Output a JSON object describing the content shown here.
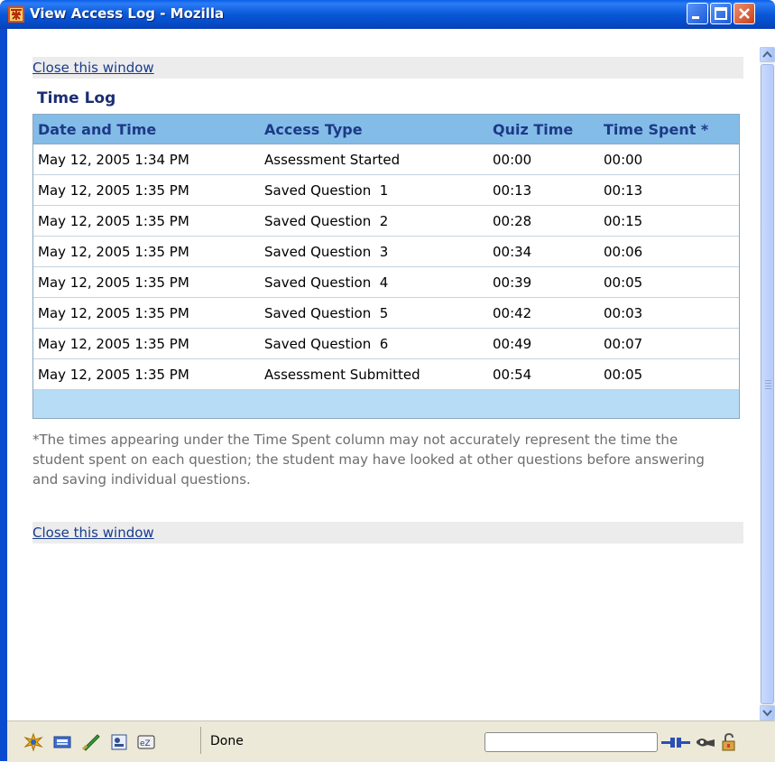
{
  "window": {
    "title": "View Access Log - Mozilla",
    "controls": [
      "minimize-icon",
      "maximize-icon",
      "close-icon"
    ]
  },
  "links": {
    "close_top": "Close this window",
    "close_bottom": "Close this window"
  },
  "time_log": {
    "title": "Time Log",
    "columns": [
      "Date and Time",
      "Access Type",
      "Quiz Time",
      "Time Spent *"
    ],
    "rows": [
      [
        "May 12, 2005 1:34 PM",
        "Assessment Started",
        "00:00",
        "00:00"
      ],
      [
        "May 12, 2005 1:35 PM",
        "Saved Question  1",
        "00:13",
        "00:13"
      ],
      [
        "May 12, 2005 1:35 PM",
        "Saved Question  2",
        "00:28",
        "00:15"
      ],
      [
        "May 12, 2005 1:35 PM",
        "Saved Question  3",
        "00:34",
        "00:06"
      ],
      [
        "May 12, 2005 1:35 PM",
        "Saved Question  4",
        "00:39",
        "00:05"
      ],
      [
        "May 12, 2005 1:35 PM",
        "Saved Question  5",
        "00:42",
        "00:03"
      ],
      [
        "May 12, 2005 1:35 PM",
        "Saved Question  6",
        "00:49",
        "00:07"
      ],
      [
        "May 12, 2005 1:35 PM",
        "Assessment Submitted",
        "00:54",
        "00:05"
      ]
    ],
    "footnote": "*The times appearing under the Time Spent column may not accurately represent the time the student spent on each question; the student may have looked at other questions before answering and saving individual questions."
  },
  "status_bar": {
    "text": "Done",
    "icons": [
      "navigator-icon",
      "mail-icon",
      "composer-icon",
      "address-book-icon",
      "irc-chat-icon"
    ],
    "right_icons": [
      "online-plug-icon",
      "security-icon",
      "lock-icon"
    ]
  },
  "colors": {
    "titlebar": "#0958d8",
    "table_header": "#84bce8",
    "table_footer": "#b7dcf6",
    "link": "#1a3b8f",
    "heading": "#1b2e73"
  }
}
